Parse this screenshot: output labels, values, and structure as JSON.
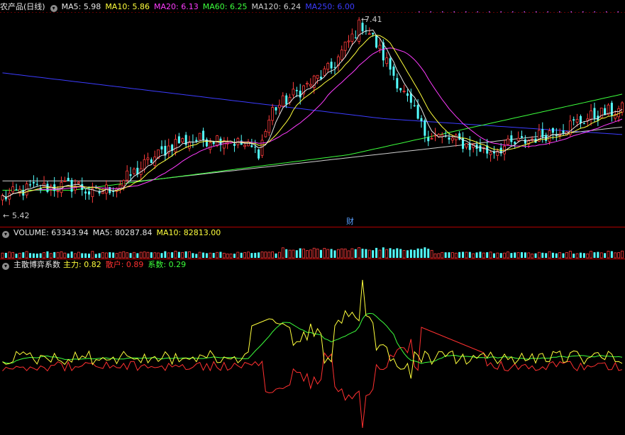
{
  "price_panel": {
    "title": "农产品(日线)",
    "legend": [
      {
        "label": "MA5",
        "value": "5.98",
        "color": "#e6e6e6"
      },
      {
        "label": "MA10",
        "value": "5.86",
        "color": "#ffff3c"
      },
      {
        "label": "MA20",
        "value": "6.13",
        "color": "#ff3cff"
      },
      {
        "label": "MA60",
        "value": "6.25",
        "color": "#3cff3c"
      },
      {
        "label": "MA120",
        "value": "6.24",
        "color": "#cfcfcf"
      },
      {
        "label": "MA250",
        "value": "6.00",
        "color": "#3c3cff"
      }
    ],
    "high_label": "7.41",
    "low_label": "5.42",
    "marker": "财"
  },
  "volume_panel": {
    "legend": [
      {
        "label": "VOLUME",
        "value": "63343.94",
        "color": "#e6e6e6"
      },
      {
        "label": "MA5",
        "value": "80287.84",
        "color": "#e6e6e6"
      },
      {
        "label": "MA10",
        "value": "82813.00",
        "color": "#ffff3c"
      }
    ]
  },
  "indicator_panel": {
    "title": "主散博弈系数",
    "legend": [
      {
        "label": "主力",
        "value": "0.82",
        "color": "#ffff3c"
      },
      {
        "label": "散户",
        "value": "0.89",
        "color": "#ff3030"
      },
      {
        "label": "系数",
        "value": "0.29",
        "color": "#3cff3c"
      }
    ]
  },
  "colors": {
    "up": "#ff3c3c",
    "down": "#54ffff",
    "grid": "#b40000"
  },
  "chart_data": {
    "type": "candlestick",
    "price_range": [
      5.42,
      7.41
    ],
    "anchors": [
      [
        0,
        5.5
      ],
      [
        8,
        5.6
      ],
      [
        22,
        5.63
      ],
      [
        26,
        5.53
      ],
      [
        33,
        5.63
      ],
      [
        50,
        6.1
      ],
      [
        64,
        6.15
      ],
      [
        74,
        6.0
      ],
      [
        78,
        6.45
      ],
      [
        95,
        6.9
      ],
      [
        104,
        7.41
      ],
      [
        112,
        6.9
      ],
      [
        122,
        6.2
      ],
      [
        132,
        6.1
      ],
      [
        140,
        6.0
      ],
      [
        150,
        6.1
      ],
      [
        165,
        6.3
      ],
      [
        172,
        6.4
      ],
      [
        178,
        6.45
      ]
    ],
    "volume_base": 0.35
  }
}
